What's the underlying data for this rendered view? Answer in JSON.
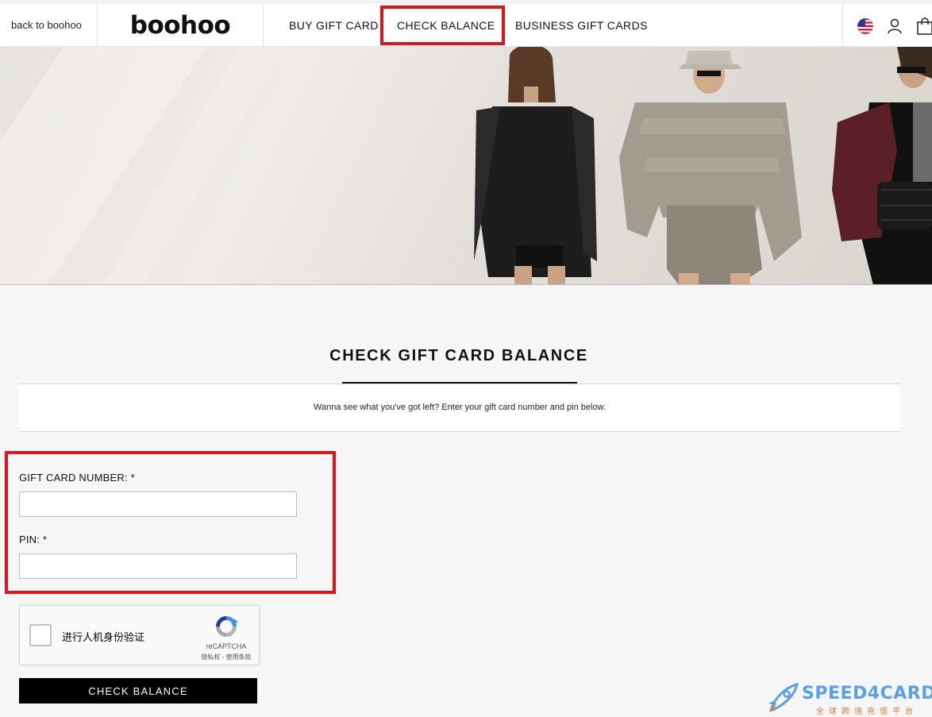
{
  "header": {
    "back_link": "back to boohoo",
    "logo": "boohoo",
    "nav": {
      "buy": "BUY GIFT CARD",
      "check": "CHECK BALANCE",
      "business": "BUSINESS GIFT CARDS"
    }
  },
  "main": {
    "title": "CHECK GIFT CARD BALANCE",
    "intro": "Wanna see what you've got left? Enter your gift card number and pin below.",
    "form": {
      "card_label": "GIFT CARD NUMBER: *",
      "card_value": "",
      "pin_label": "PIN: *",
      "pin_value": ""
    },
    "captcha": {
      "label": "进行人机身份验证",
      "brand": "reCAPTCHA",
      "terms": "隐私权 - 使用条款"
    },
    "submit_label": "CHECK BALANCE"
  },
  "watermark": {
    "name": "SPEED4CARD",
    "subtitle": "全球跨境充值平台"
  },
  "colors": {
    "highlight": "#e1141a",
    "button": "#000000",
    "watermark_blue": "#5aa0e6",
    "watermark_orange": "#e07a3a"
  }
}
